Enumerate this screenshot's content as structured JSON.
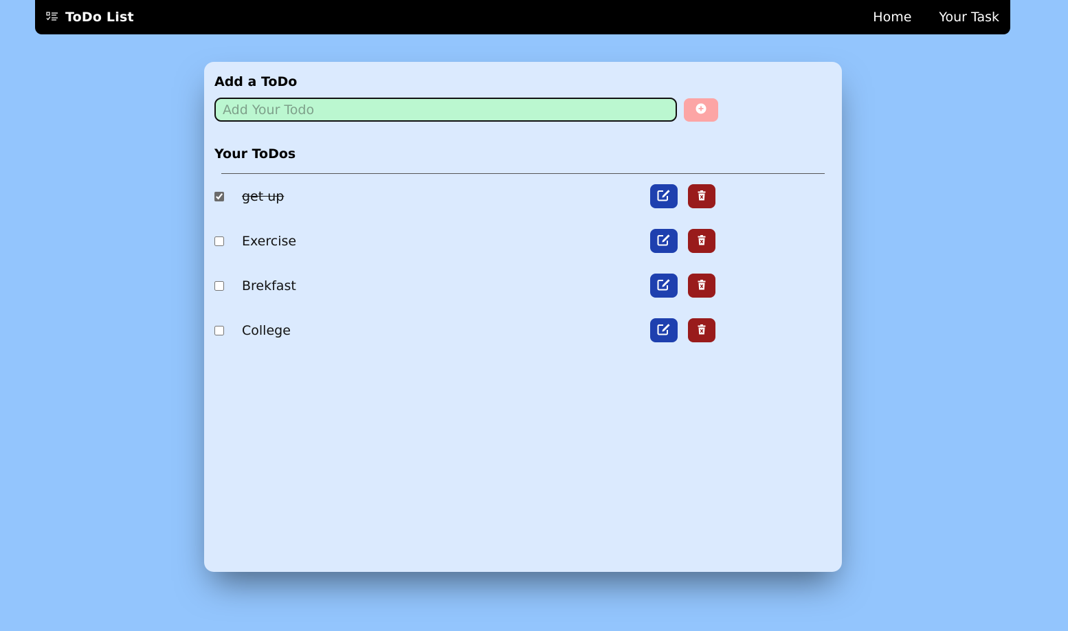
{
  "navbar": {
    "brand_icon": "checklist-icon",
    "brand": "ToDo List",
    "links": [
      "Home",
      "Your Task"
    ]
  },
  "add_section": {
    "title": "Add a ToDo",
    "input_placeholder": "Add Your Todo",
    "input_value": "",
    "add_button_icon": "plus-circle-icon"
  },
  "todos_section": {
    "title": "Your ToDos",
    "items": [
      {
        "text": "get up",
        "completed": true
      },
      {
        "text": "Exercise",
        "completed": false
      },
      {
        "text": "Brekfast",
        "completed": false
      },
      {
        "text": "College",
        "completed": false
      }
    ],
    "edit_icon": "edit-icon",
    "delete_icon": "trash-icon"
  },
  "colors": {
    "background": "#93c5fd",
    "card": "#dbeafe",
    "input_bg": "#bbf7d0",
    "add_button": "#fca5a5",
    "edit_button": "#1e40af",
    "delete_button": "#991b1b"
  }
}
